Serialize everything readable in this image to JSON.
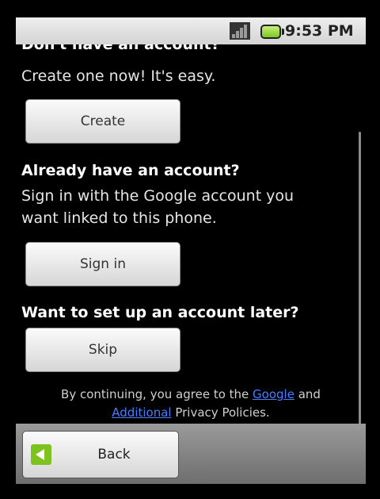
{
  "status_bar": {
    "time": "9:53 PM",
    "icons": [
      "signal-icon",
      "battery-icon"
    ]
  },
  "create_section": {
    "heading": "Don't have an account?",
    "text": "Create one now! It's easy.",
    "button_label": "Create"
  },
  "signin_section": {
    "heading": "Already have an account?",
    "text_line1": "Sign in with the Google account you",
    "text_line2": "want linked to this phone.",
    "button_label": "Sign in"
  },
  "skip_section": {
    "heading": "Want to set up an account later?",
    "button_label": "Skip"
  },
  "legal": {
    "part1": "By continuing, you agree to the ",
    "link1": "Google",
    "part2": " and",
    "link2": "Additional",
    "part3": " Privacy Policies."
  },
  "bottom_bar": {
    "back_label": "Back"
  },
  "colors": {
    "link": "#4a7cff",
    "battery": "#7cc623",
    "back_icon": "#7dc21e"
  }
}
